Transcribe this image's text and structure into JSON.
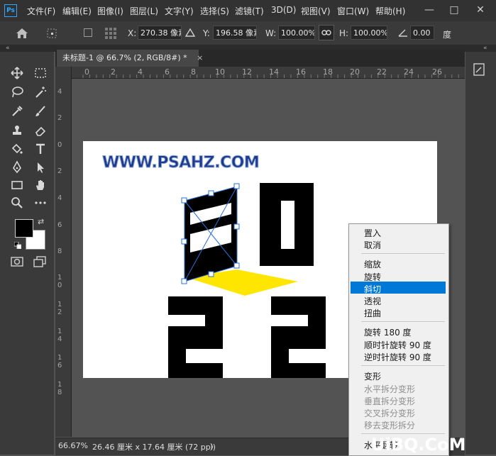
{
  "app": {
    "logo": "Ps",
    "menu": [
      "文件(F)",
      "编辑(E)",
      "图像(I)",
      "图层(L)",
      "文字(Y)",
      "选择(S)",
      "滤镜(T)",
      "3D(D)",
      "视图(V)",
      "窗口(W)",
      "帮助(H)"
    ],
    "window_controls": [
      "—",
      "□",
      "✕"
    ]
  },
  "options": {
    "x_label": "X:",
    "x_value": "270.38 像素",
    "y_label": "Y:",
    "y_value": "196.58 像素",
    "w_label": "W:",
    "w_value": "100.00%",
    "h_label": "H:",
    "h_value": "100.00%",
    "angle_value": "0.00",
    "angle_unit": "度"
  },
  "document": {
    "tab_title": "未标题-1 @ 66.7% (2, RGB/8#) *",
    "tab_close": "×"
  },
  "rulers": {
    "top": [
      "0",
      "2",
      "4",
      "6",
      "8",
      "10",
      "12",
      "14",
      "16",
      "18",
      "20",
      "22",
      "24",
      "26"
    ],
    "left": [
      "4",
      "2",
      "0",
      "2",
      "4",
      "6",
      "8",
      "1\n0",
      "1\n2",
      "1\n4",
      "1\n6",
      "1\n8"
    ]
  },
  "canvas": {
    "watermark_text": "WWW.PSAHZ.COM",
    "colors": {
      "black": "#000000",
      "yellow": "#ffe600",
      "white": "#ffffff"
    }
  },
  "status": {
    "zoom": "66.67%",
    "doc_size": "26.46 厘米 x 17.64 厘米 (72 ppi)",
    "arrow": "〉"
  },
  "context_menu": {
    "group1": [
      "置入",
      "取消"
    ],
    "group2": [
      "缩放",
      "旋转",
      "斜切",
      "透视",
      "扭曲"
    ],
    "highlighted": "斜切",
    "group3": [
      "旋转 180 度",
      "顺时针旋转 90 度",
      "逆时针旋转 90 度"
    ],
    "group4_enabled": "变形",
    "group4_disabled": [
      "水平拆分变形",
      "垂直拆分变形",
      "交叉拆分变形",
      "移去变形拆分"
    ],
    "group5": [
      "水平翻转"
    ]
  },
  "site_watermark": "UiBQ.CoM"
}
